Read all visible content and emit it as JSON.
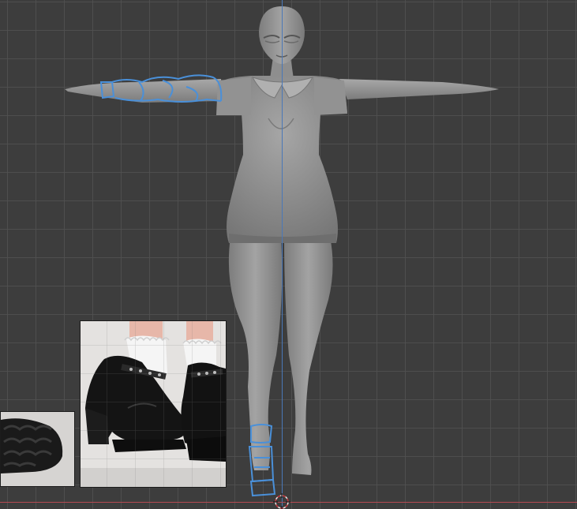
{
  "viewport": {
    "background": "#3d3d3d",
    "grid_color": "#505050",
    "axis_y_color": "#4a78b8",
    "axis_x_color": "#b44a52"
  },
  "scene": {
    "model": "sculpted-female-figure-t-pose",
    "model_color": "#8c8c8c",
    "annotation_color": "#4a90d9",
    "annotations": [
      "left-forearm-grease-pencil-strokes",
      "right-ankle-shoe-strap-strokes"
    ],
    "origin_icon": "3d-cursor-icon"
  },
  "reference_images": [
    {
      "name": "black-platform-mary-jane-shoes-reference",
      "icon": "image-icon"
    },
    {
      "name": "shoe-sole-tread-reference",
      "icon": "image-icon"
    }
  ]
}
